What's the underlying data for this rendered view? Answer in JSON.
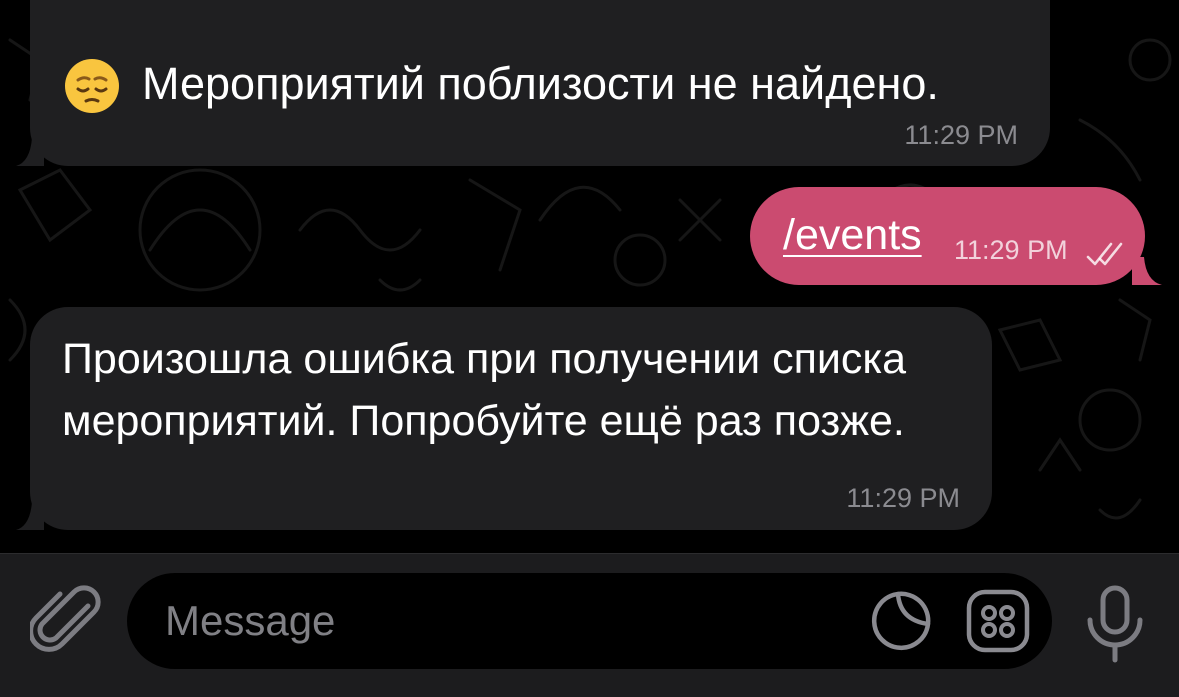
{
  "messages": [
    {
      "direction": "incoming",
      "emoji": "pensive-face",
      "text": "Мероприятий поблизости не найдено.",
      "time": "11:29 PM"
    },
    {
      "direction": "outgoing",
      "text": "/events",
      "time": "11:29 PM",
      "status": "read"
    },
    {
      "direction": "incoming",
      "text": "Произошла ошибка при получении списка мероприятий. Попробуйте ещё раз позже.",
      "time": "11:29 PM"
    }
  ],
  "input": {
    "placeholder": "Message"
  },
  "icons": {
    "attach": "paperclip-icon",
    "sticker": "sticker-icon",
    "emoji_keyboard": "emoji-keyboard-icon",
    "mic": "microphone-icon",
    "read_status": "double-check-icon"
  },
  "colors": {
    "background": "#000000",
    "incoming_bubble": "#1f1f21",
    "outgoing_bubble": "#cb4b70",
    "timestamp": "#8b8b90",
    "input_bar": "#1c1c1e"
  }
}
